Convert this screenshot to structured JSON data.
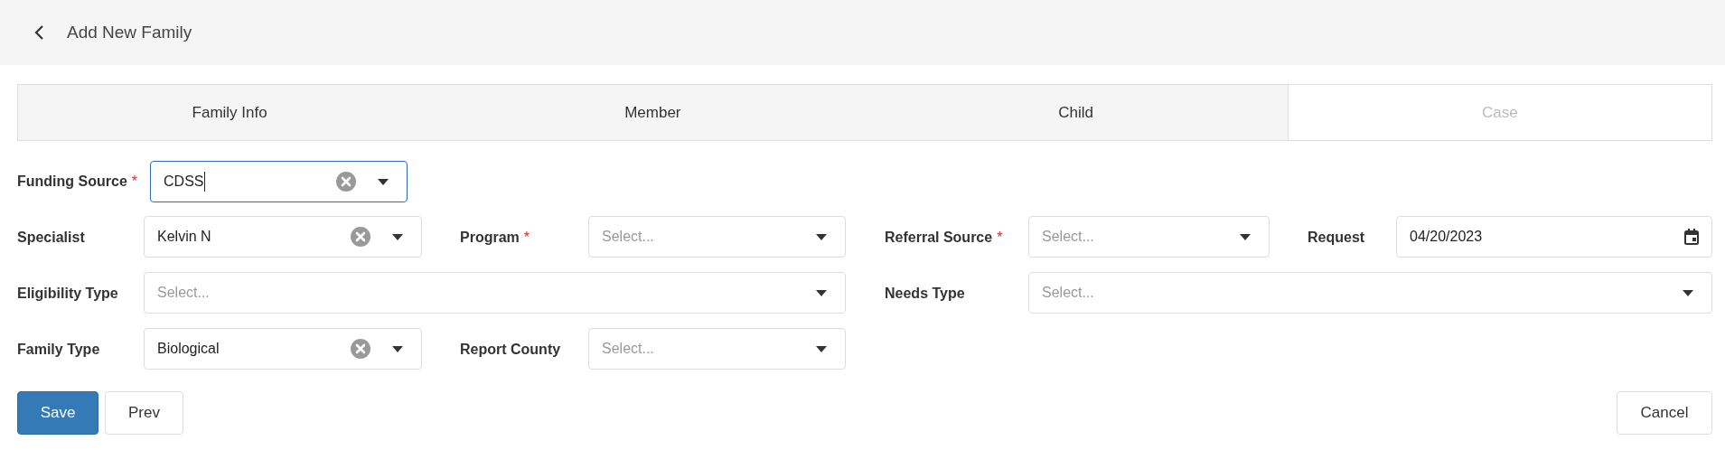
{
  "header": {
    "title": "Add New Family"
  },
  "tabs": [
    {
      "label": "Family Info",
      "selected": false
    },
    {
      "label": "Member",
      "selected": false
    },
    {
      "label": "Child",
      "selected": false
    },
    {
      "label": "Case",
      "selected": true
    }
  ],
  "funding_source": {
    "label": "Funding Source",
    "required_mark": "*",
    "value": "CDSS",
    "focused": true
  },
  "rows": [
    [
      {
        "label": "Specialist",
        "kind": "select",
        "value": "Kelvin N"
      },
      {
        "label": "Program",
        "required_mark": "*",
        "kind": "select",
        "placeholder": "Select..."
      },
      {
        "label": "Referral Source",
        "required_mark": "*",
        "kind": "select",
        "placeholder": "Select..."
      },
      {
        "label": "Request",
        "kind": "date",
        "value": "04/20/2023"
      }
    ],
    [
      {
        "label": "Eligibility Type",
        "kind": "select",
        "placeholder": "Select..."
      },
      {
        "label": "Needs Type",
        "kind": "select",
        "placeholder": "Select..."
      }
    ],
    [
      {
        "label": "Family Type",
        "kind": "select",
        "value": "Biological"
      },
      {
        "label": "Report County",
        "kind": "select",
        "placeholder": "Select..."
      }
    ]
  ],
  "buttons": {
    "save": "Save",
    "prev": "Prev",
    "cancel": "Cancel"
  }
}
